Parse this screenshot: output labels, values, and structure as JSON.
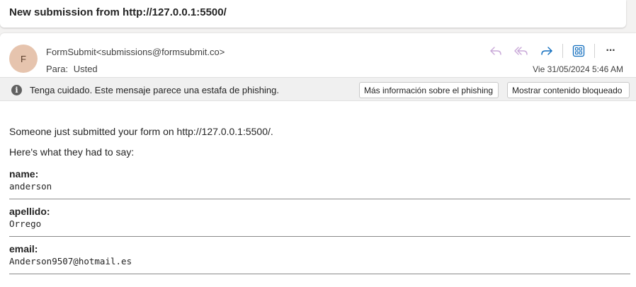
{
  "subject": "New submission from http://127.0.0.1:5500/",
  "sender": {
    "avatar_initial": "F",
    "display": "FormSubmit<submissions@formsubmit.co>"
  },
  "recipient": {
    "label": "Para:",
    "name": "Usted"
  },
  "date": "Vie 31/05/2024 5:46 AM",
  "toolbar": {
    "icons": [
      "reply-icon",
      "reply-all-icon",
      "forward-icon",
      "apps-icon",
      "more-icon"
    ],
    "more_glyph": "···"
  },
  "warning": {
    "icon_glyph": "i",
    "text": "Tenga cuidado. Este mensaje parece una estafa de phishing.",
    "more_info_label": "Más información sobre el phishing",
    "show_blocked_label": "Mostrar contenido bloqueado"
  },
  "message": {
    "intro": "Someone just submitted your form on http://127.0.0.1:5500/.",
    "said": "Here's what they had to say:",
    "fields": [
      {
        "label": "name:",
        "value": "anderson"
      },
      {
        "label": "apellido:",
        "value": "Orrego"
      },
      {
        "label": "email:",
        "value": "Anderson9507@hotmail.es"
      }
    ]
  },
  "colors": {
    "reply_disabled": "#c8a8d8",
    "forward": "#0f6cbd",
    "apps": "#0f6cbd",
    "avatar_bg": "#e6c4ae"
  }
}
